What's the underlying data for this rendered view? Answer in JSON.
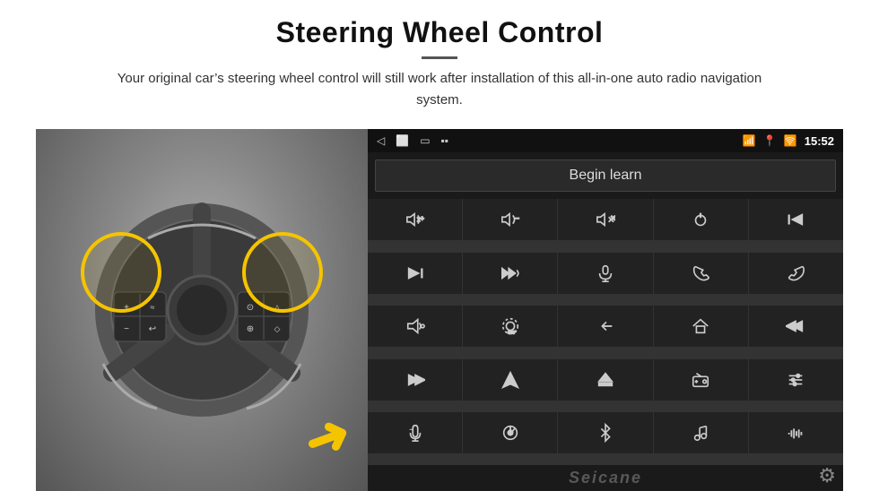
{
  "page": {
    "title": "Steering Wheel Control",
    "subtitle": "Your original car’s steering wheel control will still work after installation of this all-in-one auto radio navigation system.",
    "divider": true
  },
  "statusbar": {
    "time": "15:52",
    "icons": [
      "back-arrow",
      "home",
      "window",
      "signal"
    ]
  },
  "beginLearn": {
    "label": "Begin learn"
  },
  "controls": [
    {
      "icon": "vol-up",
      "unicode": "🔊+"
    },
    {
      "icon": "vol-down",
      "unicode": "🔉-"
    },
    {
      "icon": "mute",
      "unicode": "🔇"
    },
    {
      "icon": "power",
      "unicode": "⏻"
    },
    {
      "icon": "prev-track",
      "unicode": "⏮"
    },
    {
      "icon": "next-track",
      "unicode": "⏭"
    },
    {
      "icon": "ff-skip",
      "unicode": "⏭✕"
    },
    {
      "icon": "mic",
      "unicode": "🎤"
    },
    {
      "icon": "phone",
      "unicode": "📞"
    },
    {
      "icon": "hang-up",
      "unicode": "📵"
    },
    {
      "icon": "horn",
      "unicode": "📢"
    },
    {
      "icon": "camera360",
      "unicode": "📷"
    },
    {
      "icon": "back",
      "unicode": "↩"
    },
    {
      "icon": "home2",
      "unicode": "⌂"
    },
    {
      "icon": "skip-back",
      "unicode": "⏮"
    },
    {
      "icon": "fast-fwd",
      "unicode": "⏭"
    },
    {
      "icon": "navigate",
      "unicode": "🔱"
    },
    {
      "icon": "eject",
      "unicode": "⏏"
    },
    {
      "icon": "radio",
      "unicode": "📻"
    },
    {
      "icon": "equalizer",
      "unicode": "🎛"
    },
    {
      "icon": "mic2",
      "unicode": "🎙"
    },
    {
      "icon": "settings-dial",
      "unicode": "⚙"
    },
    {
      "icon": "bluetooth",
      "unicode": "🅱"
    },
    {
      "icon": "music",
      "unicode": "🎵"
    },
    {
      "icon": "soundwave",
      "unicode": "📶"
    }
  ],
  "watermark": {
    "text": "Seicane"
  },
  "colors": {
    "background": "#1a1a1a",
    "cellBg": "#222",
    "accent": "#f5c400",
    "iconColor": "#cccccc"
  }
}
